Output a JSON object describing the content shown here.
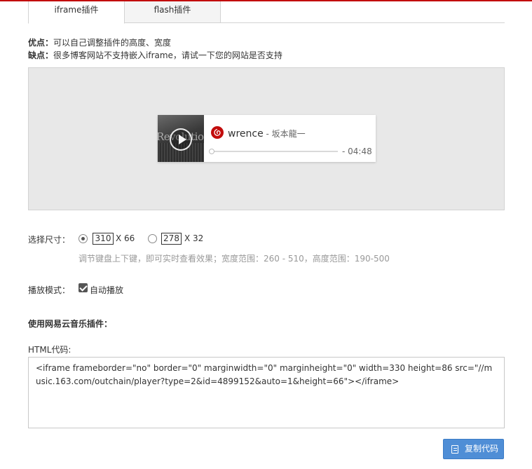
{
  "tabs": [
    {
      "label": "iframe插件",
      "active": true
    },
    {
      "label": "flash插件",
      "active": false
    }
  ],
  "info": {
    "pros_label": "优点：",
    "pros_text": "可以自己调整插件的高度、宽度",
    "cons_label": "缺点：",
    "cons_text": "很多博客网站不支持嵌入iframe，请试一下您的网站是否支持"
  },
  "player": {
    "cover_text": "Revolution",
    "song_name": "wrence",
    "artist": " - 坂本龍一",
    "time": "- 04:48",
    "progress": 0
  },
  "size": {
    "label": "选择尺寸：",
    "options": [
      {
        "width": "310",
        "height_text": "X 66",
        "selected": true
      },
      {
        "width": "278",
        "height_text": "X 32",
        "selected": false
      }
    ],
    "hint": "调节键盘上下键，即可实时查看效果；宽度范围：260 - 510，高度范围：190-500"
  },
  "mode": {
    "label": "播放模式：",
    "autoplay_label": "自动播放",
    "autoplay_checked": true
  },
  "use": {
    "title": "使用网易云音乐插件：",
    "html_label": "HTML代码:",
    "code": "<iframe frameborder=\"no\" border=\"0\" marginwidth=\"0\" marginheight=\"0\" width=330 height=86 src=\"//music.163.com/outchain/player?type=2&id=4899152&auto=1&height=66\"></iframe>",
    "copy_label": "复制代码"
  },
  "colors": {
    "accent_red": "#c20c0c",
    "button_blue": "#4f8ed6"
  }
}
